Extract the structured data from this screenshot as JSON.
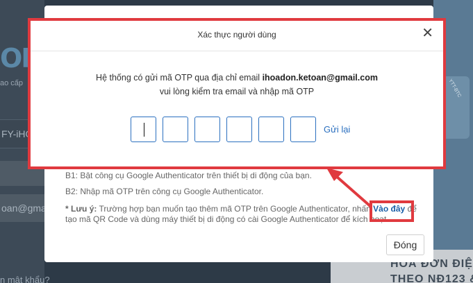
{
  "background": {
    "logo_fragment": "OF",
    "subtitle_fragment": "ao cấp",
    "field1_fragment": "FY-iHO",
    "email_fragment": "oan@gmai",
    "forgot_fragment": "n mật khẩu?",
    "device_text": "YTT-BTC",
    "promo_line1": "HOÁ ĐƠN ĐIỆ",
    "promo_line2": "THEO NĐ123 &"
  },
  "instructions": {
    "step1": "B1: Bật công cụ Google Authenticator trên thiết bị di động của bạn.",
    "step2": "B2: Nhập mã OTP trên công cụ Google Authenticator.",
    "note_label": "* Lưu ý:",
    "note_text": "Trường hợp bạn muốn tạo thêm mã OTP trên Google Authenticator, nhấn",
    "note_link": "Vào đây",
    "note_text_end": "để",
    "note_line2": "tạo mã QR Code và dùng máy thiết bị di động có cài Google Authenticator để kích hoạt",
    "close_label": "Đóng"
  },
  "otp_dialog": {
    "title": "Xác thực người dùng",
    "close_glyph": "✕",
    "message_prefix": "Hệ thống có gửi mã OTP qua địa chỉ email ",
    "email": "ihoadon.ketoan@gmail.com",
    "message_line2": "vui lòng kiểm tra email và nhập mã OTP",
    "resend_label": "Gửi lại",
    "digits": [
      "",
      "",
      "",
      "",
      "",
      ""
    ]
  },
  "colors": {
    "highlight": "#e03a3f",
    "link": "#2a6fbf"
  }
}
